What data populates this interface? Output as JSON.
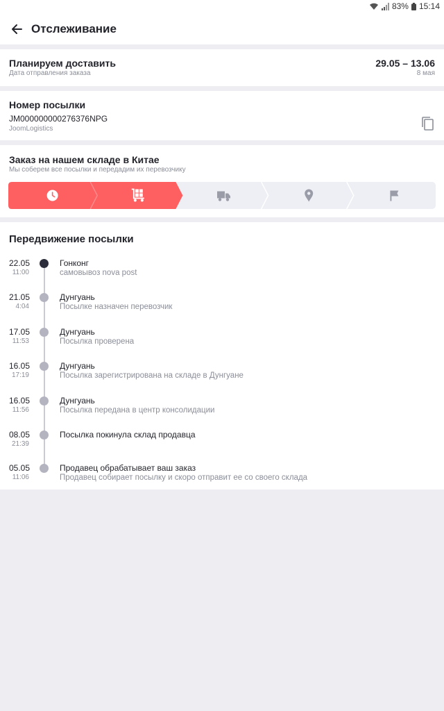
{
  "status_bar": {
    "battery": "83%",
    "time": "15:14"
  },
  "header": {
    "title": "Отслеживание"
  },
  "delivery": {
    "title": "Планируем доставить",
    "subtitle": "Дата отправления заказа",
    "range": "29.05 – 13.06",
    "sub_date": "8 мая"
  },
  "parcel": {
    "title": "Номер посылки",
    "number": "JM000000000276376NPG",
    "carrier": "JoomLogistics"
  },
  "stage": {
    "title": "Заказ на нашем складе в Китае",
    "subtitle": "Мы соберем все посылки и передадим их перевозчику",
    "steps": [
      "clock-icon",
      "warehouse-cart-icon",
      "truck-icon",
      "location-pin-icon",
      "flag-icon"
    ],
    "completed_steps": 2,
    "accent": "#fe5f61",
    "inactive": "#eeeff4"
  },
  "moves": {
    "title": "Передвижение посылки",
    "events": [
      {
        "date": "22.05",
        "time": "11:00",
        "title": "Гонконг",
        "desc": "самовывоз nova post",
        "current": true
      },
      {
        "date": "21.05",
        "time": "4:04",
        "title": "Дунгуань",
        "desc": "Посылке назначен перевозчик",
        "current": false
      },
      {
        "date": "17.05",
        "time": "11:53",
        "title": "Дунгуань",
        "desc": "Посылка проверена",
        "current": false
      },
      {
        "date": "16.05",
        "time": "17:19",
        "title": "Дунгуань",
        "desc": "Посылка зарегистрирована на складе в Дунгуане",
        "current": false
      },
      {
        "date": "16.05",
        "time": "11:56",
        "title": "Дунгуань",
        "desc": "Посылка передана в центр консолидации",
        "current": false
      },
      {
        "date": "08.05",
        "time": "21:39",
        "title": "Посылка покинула склад продавца",
        "desc": "",
        "current": false
      },
      {
        "date": "05.05",
        "time": "11:06",
        "title": "Продавец обрабатывает ваш заказ",
        "desc": "Продавец собирает посылку и скоро отправит ее со своего склада",
        "current": false
      }
    ]
  }
}
